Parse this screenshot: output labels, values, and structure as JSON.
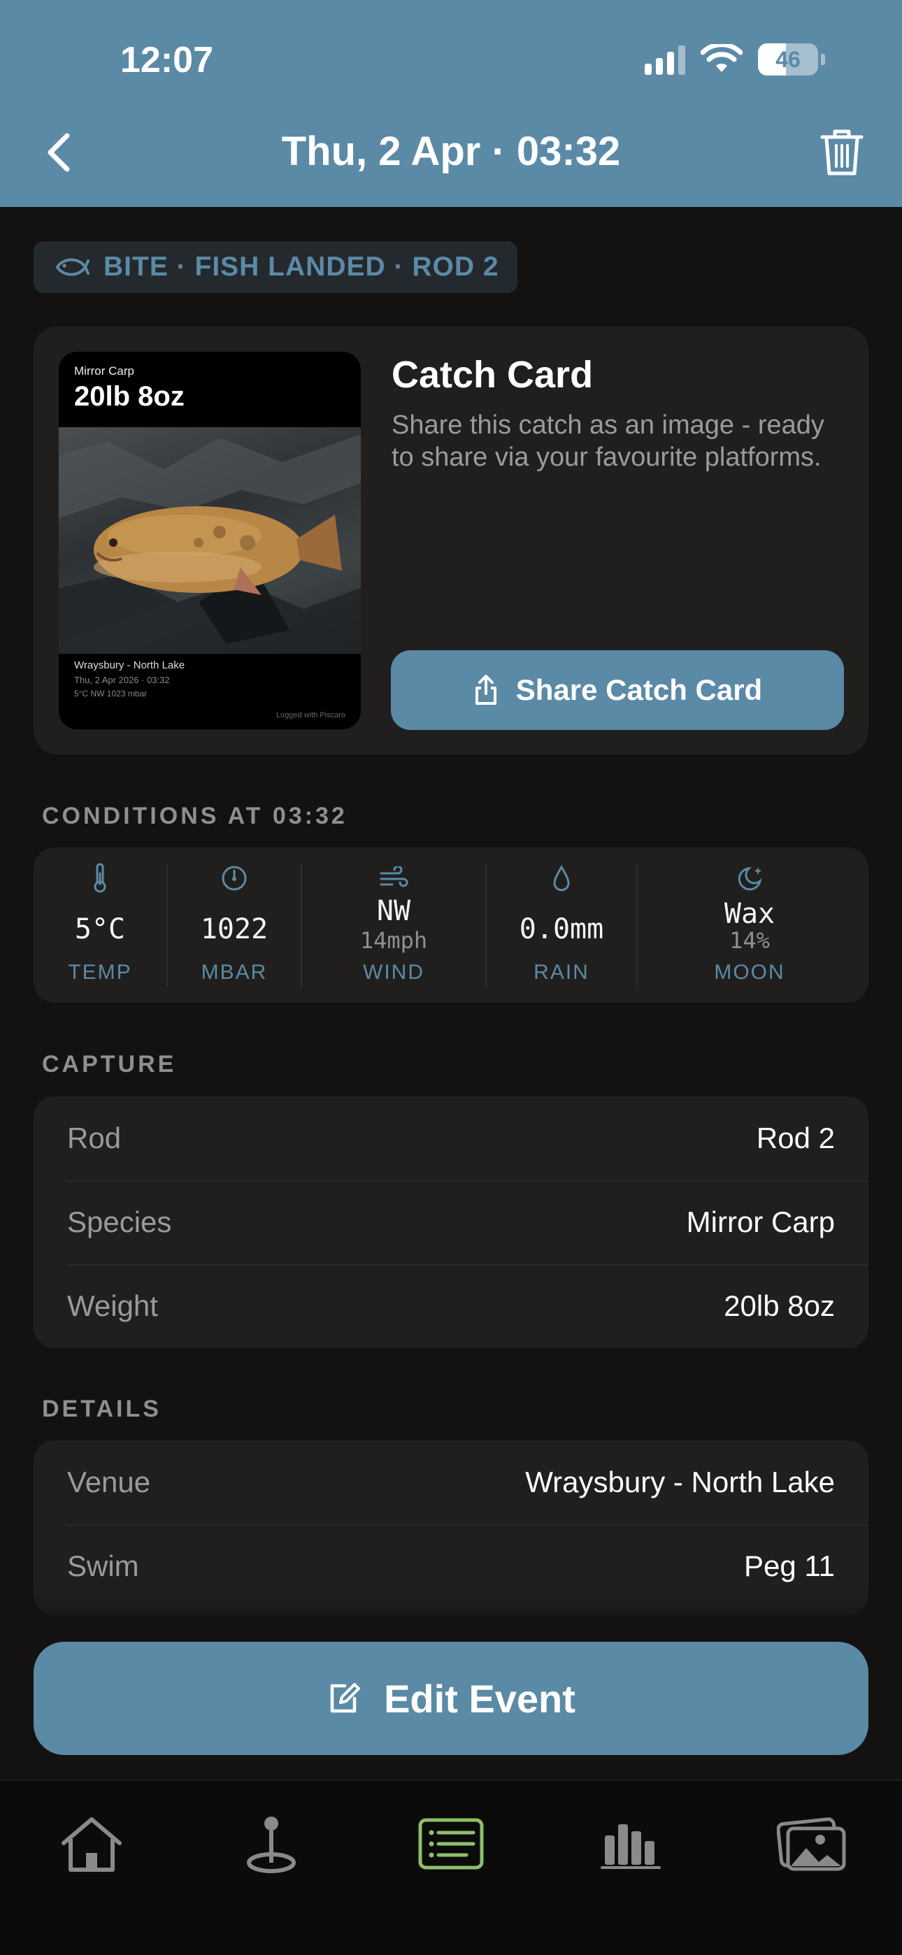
{
  "status_bar": {
    "time": "12:07",
    "battery": "46"
  },
  "nav": {
    "title": "Thu, 2 Apr · 03:32"
  },
  "event_tag": {
    "label": "BITE · FISH LANDED · ROD 2"
  },
  "catch_card": {
    "title": "Catch Card",
    "description": "Share this catch as an image - ready to share via your favourite platforms.",
    "share_label": "Share Catch Card",
    "preview": {
      "species": "Mirror Carp",
      "weight": "20lb 8oz",
      "venue": "Wraysbury - North Lake",
      "datetime": "Thu, 2 Apr 2026 · 03:32",
      "conditions": "5°C   NW   1023 mbar",
      "footer": "Logged with Piscaro"
    }
  },
  "conditions": {
    "heading": "CONDITIONS AT 03:32",
    "items": [
      {
        "icon": "thermometer-icon",
        "value": "5°C",
        "sub": "",
        "label": "TEMP"
      },
      {
        "icon": "gauge-icon",
        "value": "1022",
        "sub": "",
        "label": "MBAR"
      },
      {
        "icon": "wind-icon",
        "value": "NW",
        "sub": "14mph",
        "label": "WIND"
      },
      {
        "icon": "raindrop-icon",
        "value": "0.0mm",
        "sub": "",
        "label": "RAIN"
      },
      {
        "icon": "moon-icon",
        "value": "Wax",
        "sub": "14%",
        "label": "MOON"
      }
    ]
  },
  "capture": {
    "heading": "CAPTURE",
    "rows": [
      {
        "key": "Rod",
        "value": "Rod 2"
      },
      {
        "key": "Species",
        "value": "Mirror Carp"
      },
      {
        "key": "Weight",
        "value": "20lb 8oz"
      }
    ]
  },
  "details": {
    "heading": "DETAILS",
    "rows": [
      {
        "key": "Venue",
        "value": "Wraysbury - North Lake"
      },
      {
        "key": "Swim",
        "value": "Peg 11"
      }
    ]
  },
  "edit_button": {
    "label": "Edit Event"
  },
  "tabbar": {
    "active": "log",
    "tabs": [
      "home-icon",
      "map-pin-icon",
      "log-list-icon",
      "stats-icon",
      "gallery-icon"
    ]
  },
  "colors": {
    "accent": "#5b8aa6",
    "active_tab": "#8fbf6a",
    "background": "#131211",
    "card": "#201f1e"
  }
}
